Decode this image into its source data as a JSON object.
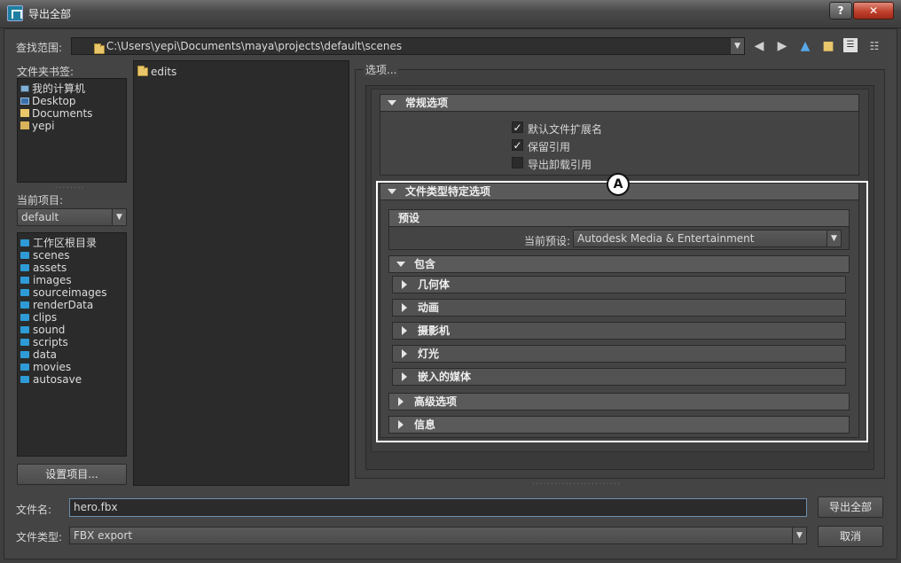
{
  "window": {
    "title": "导出全部",
    "help_label": "?",
    "close_label": "✕"
  },
  "lookin": {
    "label": "查找范围:",
    "path": "C:\\Users\\yepi\\Documents\\maya\\projects\\default\\scenes"
  },
  "bookmarks": {
    "label": "文件夹书签:",
    "items": [
      {
        "label": "我的计算机",
        "icon": "computer-icon"
      },
      {
        "label": "Desktop",
        "icon": "desktop-icon"
      },
      {
        "label": "Documents",
        "icon": "folder-icon"
      },
      {
        "label": "yepi",
        "icon": "user-folder-icon"
      }
    ]
  },
  "project": {
    "label": "当前项目:",
    "value": "default",
    "folders": [
      "工作区根目录",
      "scenes",
      "assets",
      "images",
      "sourceimages",
      "renderData",
      "clips",
      "sound",
      "scripts",
      "data",
      "movies",
      "autosave"
    ],
    "set_button": "设置项目..."
  },
  "files": {
    "items": [
      "edits"
    ]
  },
  "options": {
    "label": "选项...",
    "general": {
      "title": "常规选项",
      "checks": [
        {
          "label": "默认文件扩展名",
          "checked": true
        },
        {
          "label": "保留引用",
          "checked": true
        },
        {
          "label": "导出卸载引用",
          "checked": false
        }
      ]
    },
    "filetype": {
      "title": "文件类型特定选项",
      "annotation": "A",
      "preset_title": "预设",
      "current_preset_label": "当前预设:",
      "current_preset_value": "Autodesk Media & Entertainment",
      "include_title": "包含",
      "include_items": [
        "几何体",
        "动画",
        "摄影机",
        "灯光",
        "嵌入的媒体"
      ],
      "advanced_title": "高级选项",
      "info_title": "信息"
    }
  },
  "bottom": {
    "filename_label": "文件名:",
    "filename_value": "hero.fbx",
    "filetype_label": "文件类型:",
    "filetype_value": "FBX export",
    "export_button": "导出全部",
    "cancel_button": "取消"
  }
}
